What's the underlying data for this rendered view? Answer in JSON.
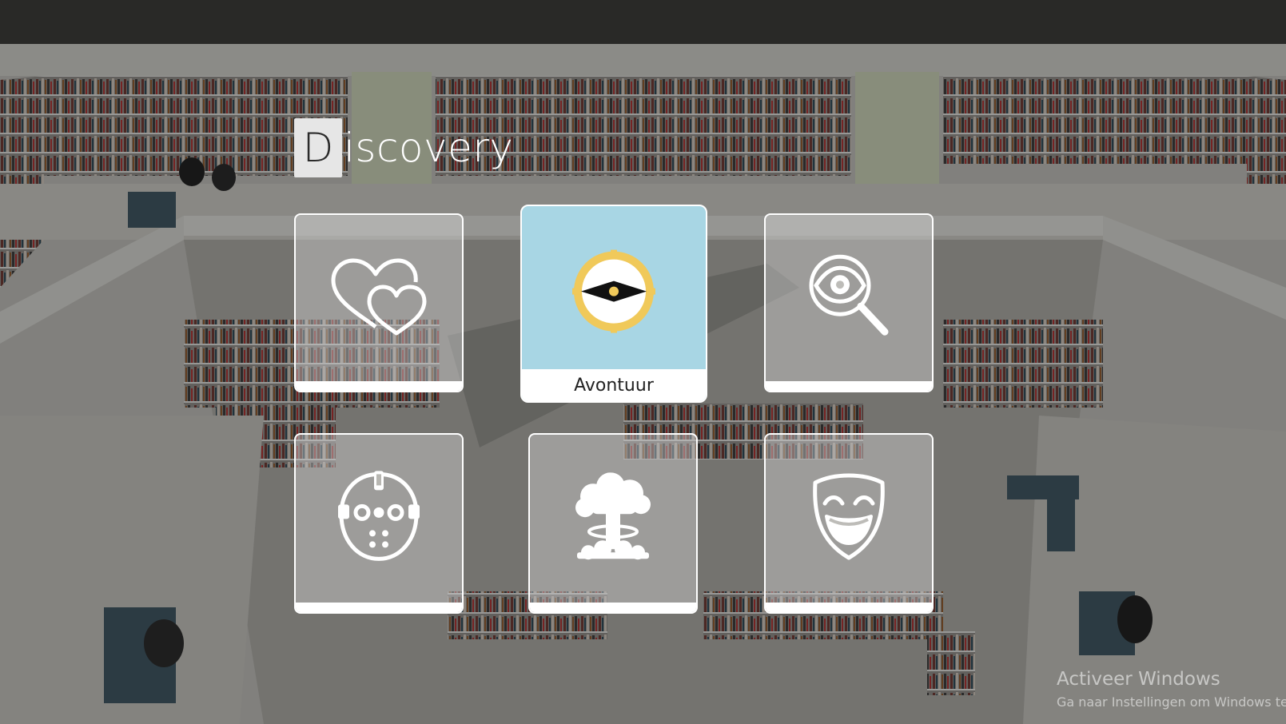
{
  "app": {
    "logo_letter": "D",
    "logo_rest": "iscovery"
  },
  "genres": [
    {
      "icon": "hearts-icon",
      "label": "",
      "selected": false
    },
    {
      "icon": "compass-icon",
      "label": "Avontuur",
      "selected": true
    },
    {
      "icon": "magnifier-eye-icon",
      "label": "",
      "selected": false
    },
    {
      "icon": "hockey-mask-icon",
      "label": "",
      "selected": false
    },
    {
      "icon": "explosion-icon",
      "label": "",
      "selected": false
    },
    {
      "icon": "comedy-mask-icon",
      "label": "",
      "selected": false
    }
  ],
  "watermark": {
    "title": "Activeer Windows",
    "subtitle": "Ga naar Instellingen om Windows te"
  },
  "colors": {
    "selected_tile": "#a8d6e4",
    "compass_ring": "#f0c95a",
    "icon_stroke": "#ffffff"
  }
}
